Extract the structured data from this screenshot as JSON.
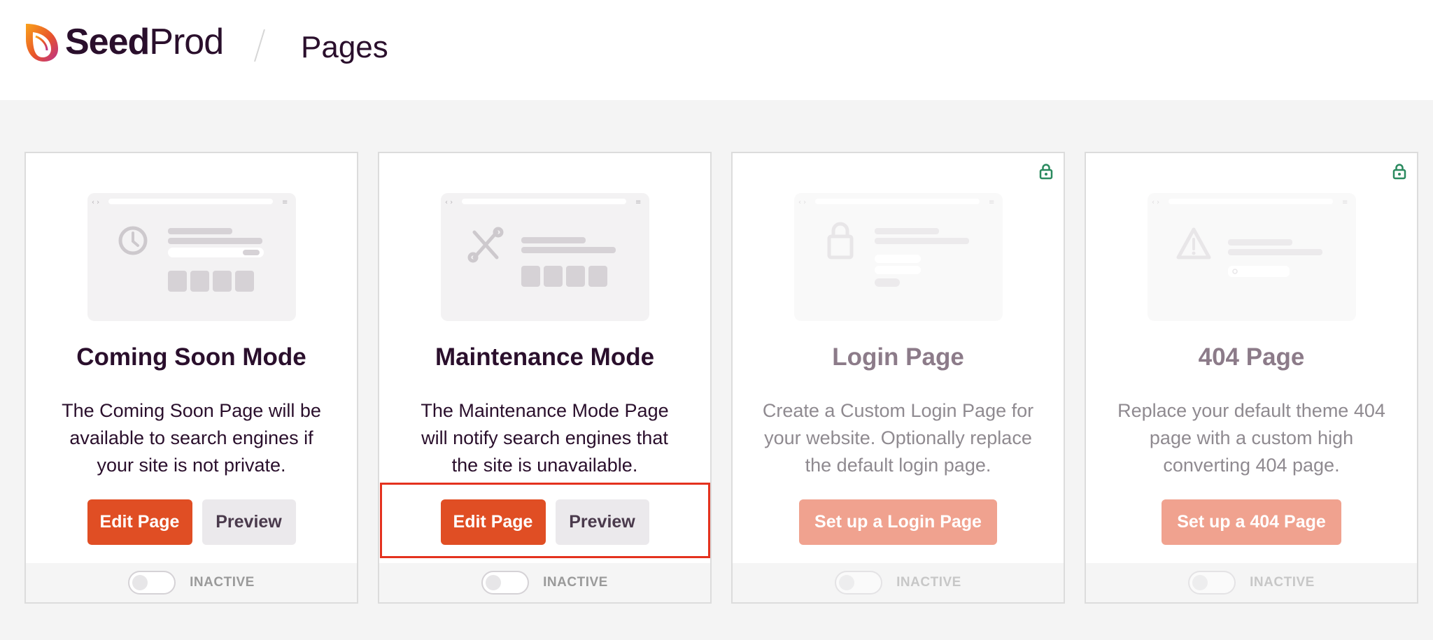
{
  "header": {
    "brand_bold": "Seed",
    "brand_light": "Prod",
    "page_title": "Pages"
  },
  "colors": {
    "accent": "#e04e24",
    "brand_dark": "#2a0f2c",
    "highlight": "#e4321e",
    "lock_green": "#2a8a5f"
  },
  "cards": [
    {
      "title": "Coming Soon Mode",
      "description": "The Coming Soon Page will be available to search engines if your site is not private.",
      "thumbnail_icon": "clock-icon",
      "primary_label": "Edit Page",
      "secondary_label": "Preview",
      "status": "INACTIVE",
      "locked": false
    },
    {
      "title": "Maintenance Mode",
      "description": "The Maintenance Mode Page will notify search engines that the site is unavailable.",
      "thumbnail_icon": "tools-icon",
      "primary_label": "Edit Page",
      "secondary_label": "Preview",
      "status": "INACTIVE",
      "locked": false,
      "highlighted": true
    },
    {
      "title": "Login Page",
      "description": "Create a Custom Login Page for your website. Optionally replace the default login page.",
      "thumbnail_icon": "padlock-icon",
      "primary_label": "Set up a Login Page",
      "status": "INACTIVE",
      "locked": true
    },
    {
      "title": "404 Page",
      "description": "Replace your default theme 404 page with a custom high converting 404 page.",
      "thumbnail_icon": "warning-icon",
      "primary_label": "Set up a 404 Page",
      "status": "INACTIVE",
      "locked": true
    }
  ]
}
